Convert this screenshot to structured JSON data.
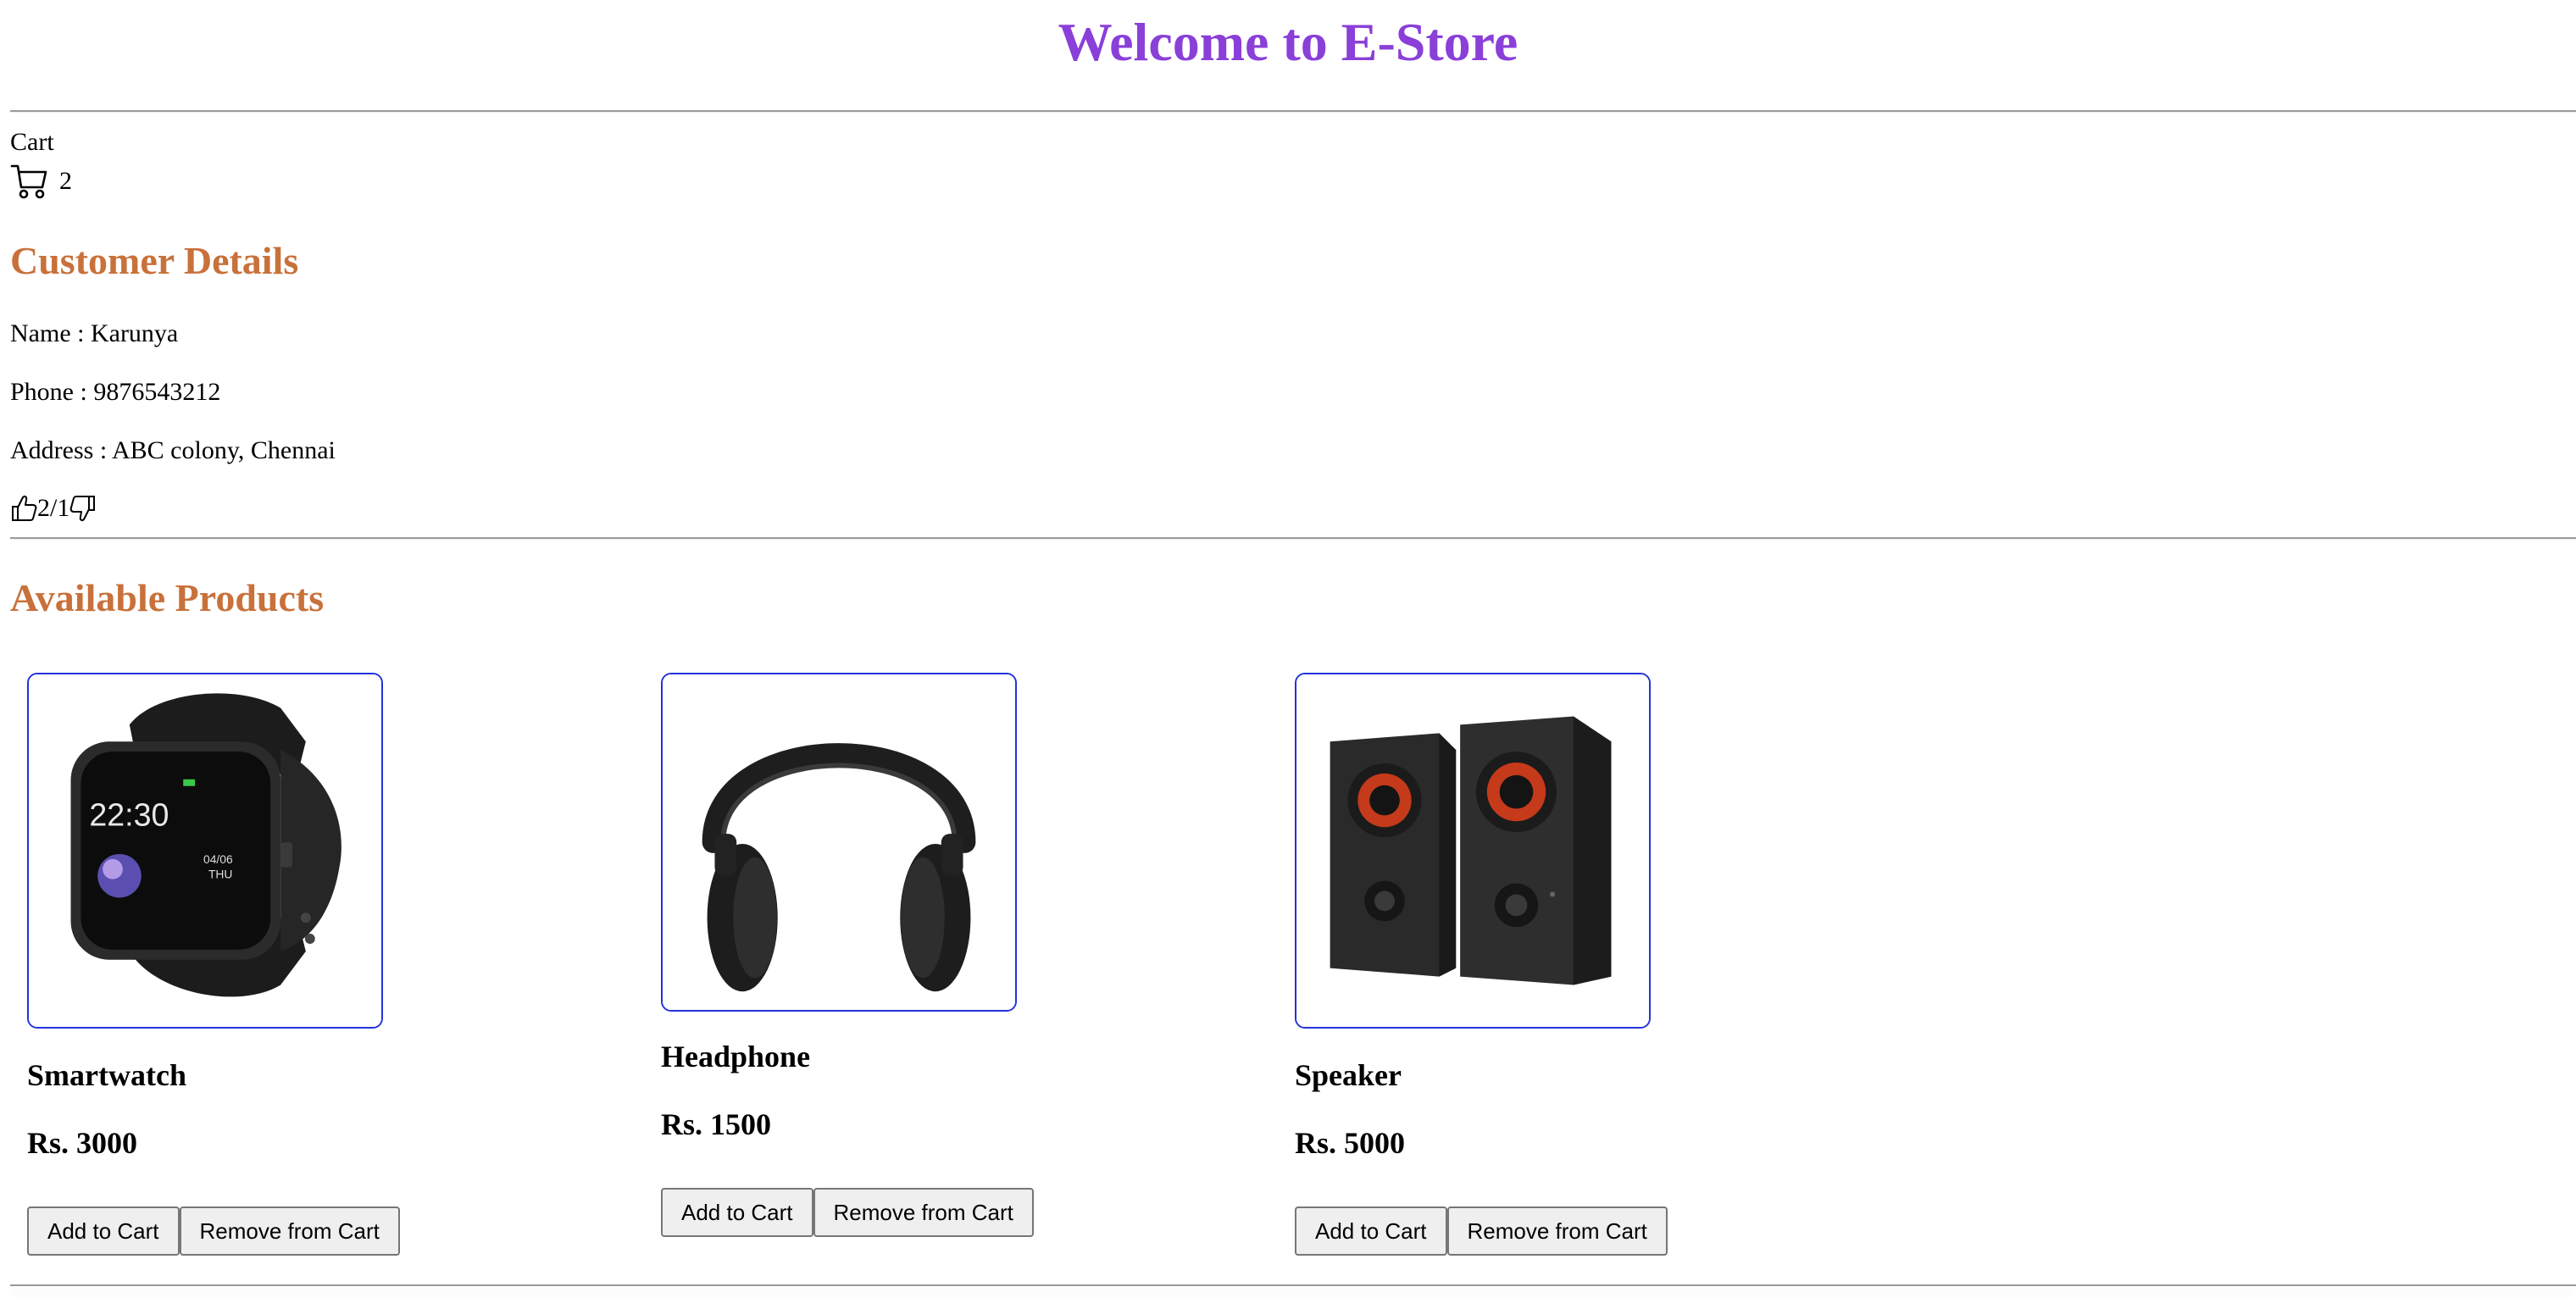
{
  "header": {
    "title": "Welcome to E-Store",
    "title_color": "#8a3fd8"
  },
  "cart": {
    "label": "Cart",
    "icon": "cart-icon",
    "count": "2"
  },
  "customer": {
    "heading": "Customer Details",
    "heading_color": "#c8713a",
    "name": "Name : Karunya",
    "phone": "Phone : 9876543212",
    "address": "Address : ABC colony, Chennai",
    "likes_text": "2/1",
    "like_icon": "thumbs-up-icon",
    "dislike_icon": "thumbs-down-icon"
  },
  "products": {
    "heading": "Available Products",
    "heading_color": "#c8713a",
    "card_border_color": "#2233dd",
    "items": [
      {
        "name": "Smartwatch",
        "price": "Rs. 3000",
        "image": "smartwatch-image",
        "add_label": "Add to Cart",
        "remove_label": "Remove from Cart"
      },
      {
        "name": "Headphone",
        "price": "Rs. 1500",
        "image": "headphone-image",
        "add_label": "Add to Cart",
        "remove_label": "Remove from Cart"
      },
      {
        "name": "Speaker",
        "price": "Rs. 5000",
        "image": "speaker-image",
        "add_label": "Add to Cart",
        "remove_label": "Remove from Cart"
      }
    ]
  }
}
